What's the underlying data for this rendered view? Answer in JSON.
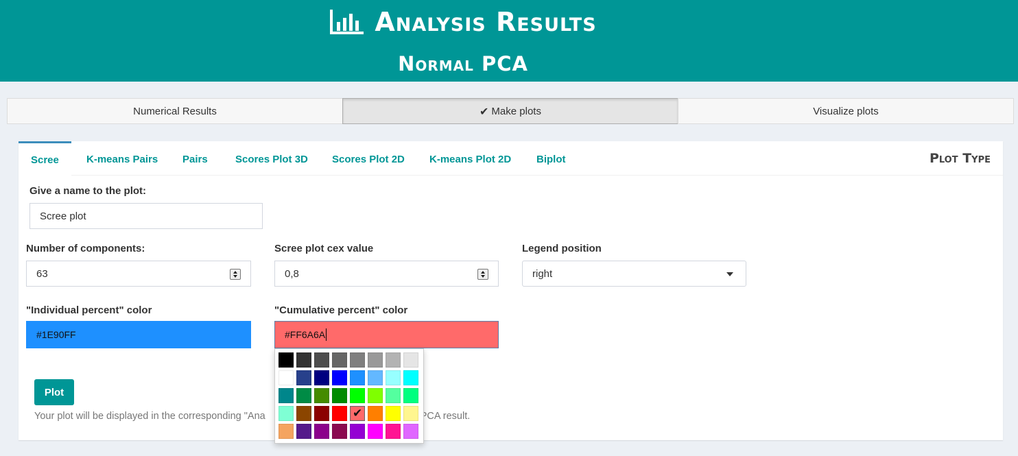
{
  "header": {
    "title": "Analysis Results",
    "subtitle": "Normal PCA",
    "icon": "bar-chart-icon"
  },
  "topnav": [
    {
      "label": "Numerical Results",
      "active": false
    },
    {
      "label": "Make plots",
      "active": true,
      "icon": "check-icon"
    },
    {
      "label": "Visualize plots",
      "active": false
    }
  ],
  "plot_tabs": [
    "Scree",
    "K-means Pairs",
    "Pairs",
    "Scores Plot 3D",
    "Scores Plot 2D",
    "K-means Plot 2D",
    "Biplot"
  ],
  "plot_type_label": "Plot Type",
  "form": {
    "name_label": "Give a name to the plot:",
    "name_value": "Scree plot",
    "components_label": "Number of components:",
    "components_value": "63",
    "cex_label": "Scree plot cex value",
    "cex_value": "0,8",
    "legend_label": "Legend position",
    "legend_value": "right",
    "individual_label": "\"Individual percent\" color",
    "individual_value": "#1E90FF",
    "cumulative_label": "\"Cumulative percent\" color",
    "cumulative_value": "#FF6A6A"
  },
  "plot_button": "Plot",
  "help_text": "Your plot will be displayed in the corresponding \"Ana",
  "help_text_tail": "PCA result.",
  "palette": {
    "selected": "#FF6A6A",
    "rows": [
      [
        "#000000",
        "#333333",
        "#4D4D4D",
        "#666666",
        "#7F7F7F",
        "#999999",
        "#B3B3B3",
        "#E5E5E5"
      ],
      [
        "#FFFFFF",
        "#27408B",
        "#000080",
        "#0000FF",
        "#1E90FF",
        "#63B8FF",
        "#97FFFF",
        "#00FFFF"
      ],
      [
        "#00868B",
        "#008B45",
        "#458B00",
        "#008B00",
        "#00FF00",
        "#7FFF00",
        "#54FF9F",
        "#00FF7F"
      ],
      [
        "#7FFFD4",
        "#8B4500",
        "#8B0000",
        "#FF0000",
        "#FF6A6A",
        "#FF7F00",
        "#FFFF00",
        "#FFF68F"
      ],
      [
        "#F4A460",
        "#551A8B",
        "#8B008B",
        "#8B0A50",
        "#9400D3",
        "#FF00FF",
        "#FF1493",
        "#E066FF"
      ]
    ]
  }
}
